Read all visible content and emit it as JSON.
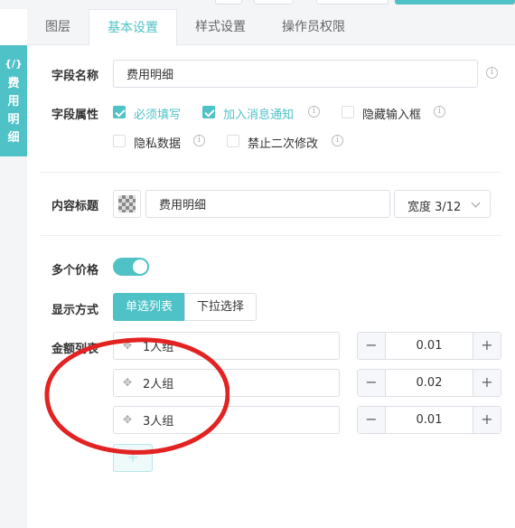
{
  "tabs": [
    "图层",
    "基本设置",
    "样式设置",
    "操作员权限"
  ],
  "active_tab": 1,
  "side_tab": {
    "icon": "{/}",
    "label": "费用明细"
  },
  "field_name": {
    "label": "字段名称",
    "value": "费用明细"
  },
  "field_attr": {
    "label": "字段属性",
    "options": [
      {
        "label": "必须填写",
        "checked": true,
        "info": false
      },
      {
        "label": "加入消息通知",
        "checked": true,
        "info": true
      },
      {
        "label": "隐藏输入框",
        "checked": false,
        "info": true
      },
      {
        "label": "隐私数据",
        "checked": false,
        "info": true
      },
      {
        "label": "禁止二次修改",
        "checked": false,
        "info": true
      }
    ]
  },
  "content_title": {
    "label": "内容标题",
    "value": "费用明细",
    "width_select": "宽度 3/12"
  },
  "multi_price": {
    "label": "多个价格",
    "enabled": true
  },
  "display_mode": {
    "label": "显示方式",
    "options": [
      "单选列表",
      "下拉选择"
    ],
    "active": 0
  },
  "amount_list": {
    "label": "金额列表",
    "rows": [
      {
        "name": "1人组",
        "value": "0.01"
      },
      {
        "name": "2人组",
        "value": "0.02"
      },
      {
        "name": "3人组",
        "value": "0.01"
      }
    ],
    "add_label": "+"
  },
  "colors": {
    "accent": "#4ec2c7",
    "annotation": "#e32222"
  },
  "icons": {
    "info": "info-icon",
    "drag": "drag-handle-icon",
    "minus": "minus-icon",
    "plus": "plus-icon",
    "chevron": "chevron-down-icon"
  }
}
